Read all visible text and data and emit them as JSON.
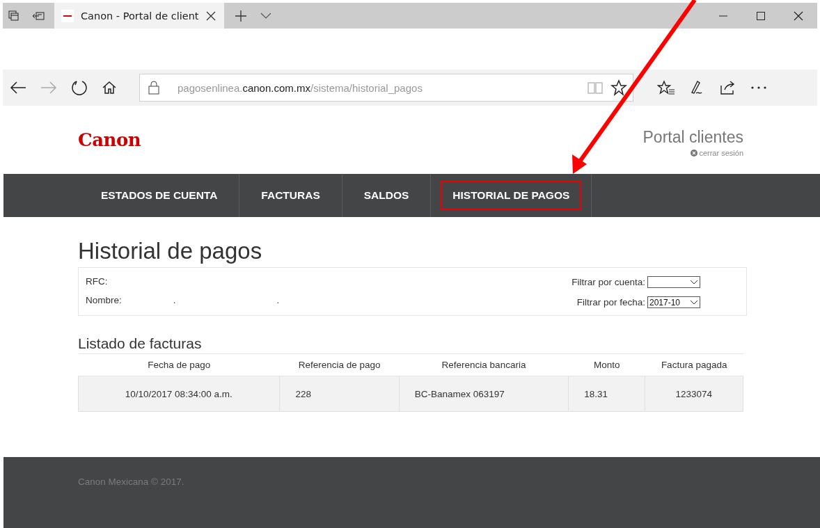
{
  "browser": {
    "tab_title": "Canon - Portal de client",
    "url_host": "pagosenlinea.",
    "url_domain": "canon.com.mx",
    "url_path": "/sistema/historial_pagos"
  },
  "header": {
    "logo": "Canon",
    "portal_title": "Portal clientes",
    "logout": "cerrar sesión"
  },
  "nav": [
    {
      "label": "ESTADOS DE CUENTA",
      "highlighted": false
    },
    {
      "label": "FACTURAS",
      "highlighted": false
    },
    {
      "label": "SALDOS",
      "highlighted": false
    },
    {
      "label": "HISTORIAL DE PAGOS",
      "highlighted": true
    }
  ],
  "page_title": "Historial de pagos",
  "info": {
    "rfc_label": "RFC:",
    "name_label": "Nombre:",
    "name_value_1": ".",
    "name_value_2": ".",
    "filter_account_label": "Filtrar por cuenta:",
    "filter_date_label": "Filtrar por fecha:",
    "filter_date_value": "2017-10"
  },
  "list_title": "Listado de facturas",
  "table": {
    "columns": [
      "Fecha de pago",
      "Referencia de pago",
      "Referencia bancaria",
      "Monto",
      "Factura pagada"
    ],
    "rows": [
      [
        "10/10/2017 08:34:00 a.m.",
        "228",
        "BC-Banamex 063197",
        "18.31",
        "1233074"
      ]
    ]
  },
  "footer": "Canon Mexicana © 2017."
}
